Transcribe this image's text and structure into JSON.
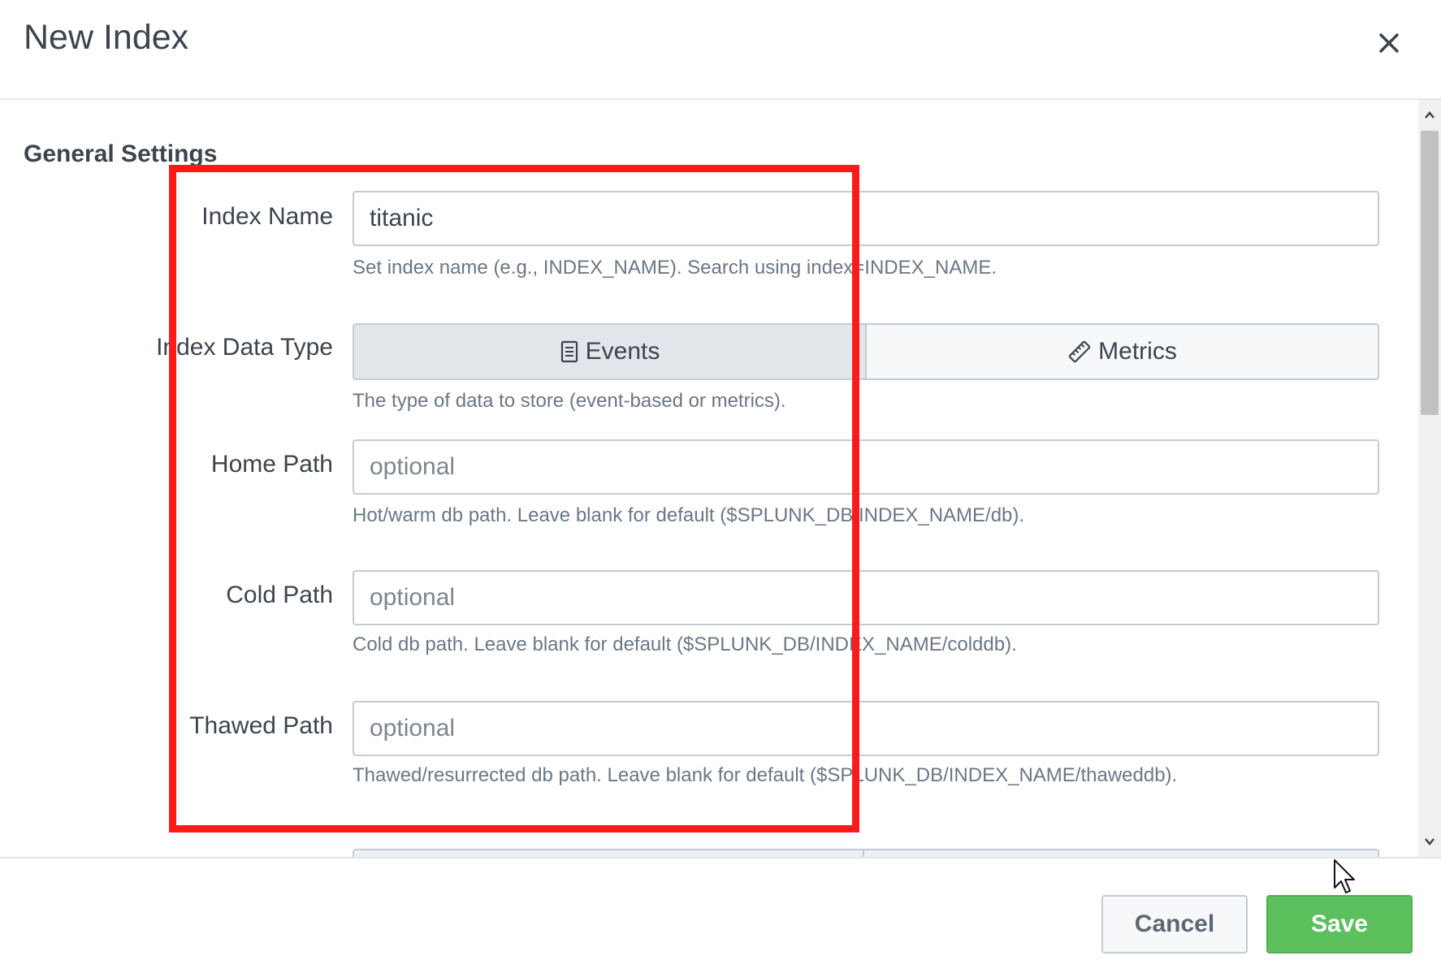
{
  "dialog": {
    "title": "New Index"
  },
  "general_settings": {
    "section_title": "General Settings",
    "index_name": {
      "label": "Index Name",
      "value": "titanic",
      "help": "Set index name (e.g., INDEX_NAME). Search using index=INDEX_NAME."
    },
    "index_data_type": {
      "label": "Index Data Type",
      "options": [
        {
          "label": "Events",
          "icon": "document-icon",
          "selected": true
        },
        {
          "label": "Metrics",
          "icon": "ruler-icon",
          "selected": false
        }
      ],
      "help": "The type of data to store (event-based or metrics)."
    },
    "home_path": {
      "label": "Home Path",
      "placeholder": "optional",
      "help": "Hot/warm db path. Leave blank for default ($SPLUNK_DB/INDEX_NAME/db)."
    },
    "cold_path": {
      "label": "Cold Path",
      "placeholder": "optional",
      "help": "Cold db path. Leave blank for default ($SPLUNK_DB/INDEX_NAME/colddb)."
    },
    "thawed_path": {
      "label": "Thawed Path",
      "placeholder": "optional",
      "help": "Thawed/resurrected db path. Leave blank for default ($SPLUNK_DB/INDEX_NAME/thaweddb)."
    }
  },
  "footer": {
    "cancel_label": "Cancel",
    "save_label": "Save"
  },
  "colors": {
    "save_green": "#5cc05c",
    "highlight_red": "#ff1a1a",
    "text": "#3c444d",
    "help_text": "#6b7785"
  }
}
